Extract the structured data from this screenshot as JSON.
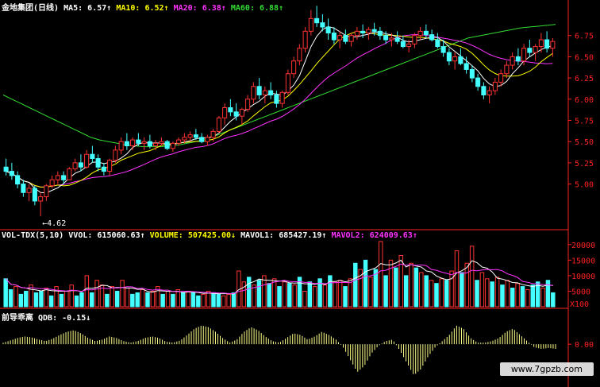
{
  "headers": {
    "price": {
      "title": "金地集团(日线)",
      "items": [
        {
          "label": "MA5: 6.57↑",
          "color": "#ffffff"
        },
        {
          "label": "MA10: 6.52↑",
          "color": "#ffff00"
        },
        {
          "label": "MA20: 6.38↑",
          "color": "#ff33ff"
        },
        {
          "label": "MA60: 6.88↑",
          "color": "#33dd33"
        }
      ]
    },
    "volume": {
      "items": [
        {
          "label": "VOL-TDX(5,10) VVOL: 615060.63↑",
          "color": "#ffffff"
        },
        {
          "label": "VOLUME: 507425.00↓",
          "color": "#ffff00"
        },
        {
          "label": "MAVOL1: 685427.19↑",
          "color": "#ffffff"
        },
        {
          "label": "MAVOL2: 624009.63↑",
          "color": "#ff33ff"
        }
      ]
    },
    "indicator": {
      "items": [
        {
          "label": "前导乖离 QDB: -0.15↓",
          "color": "#ffffff"
        }
      ]
    }
  },
  "watermark": "www.7gpzb.com",
  "colors": {
    "up": "#ff3333",
    "down": "#44ffff",
    "ma5": "#ffffff",
    "ma10": "#ffff00",
    "ma20": "#ff33ff",
    "ma60": "#33dd33",
    "axis": "#ff2222",
    "bars": "#ffff88"
  },
  "chart_data": [
    {
      "type": "candlestick",
      "title": "金地集团(日线)",
      "ylim": [
        4.5,
        7.0
      ],
      "y_ticks": [
        5.0,
        5.25,
        5.5,
        5.75,
        6.0,
        6.25,
        6.5,
        6.75
      ],
      "annotation": "←4.62",
      "low_annotation_value": 4.62,
      "candles": [
        [
          5.2,
          5.3,
          5.1,
          5.15
        ],
        [
          5.15,
          5.25,
          5.05,
          5.1
        ],
        [
          5.1,
          5.15,
          4.95,
          5.0
        ],
        [
          5.0,
          5.05,
          4.85,
          4.9
        ],
        [
          4.9,
          5.0,
          4.8,
          4.95
        ],
        [
          4.95,
          4.98,
          4.75,
          4.8
        ],
        [
          4.8,
          4.9,
          4.62,
          4.85
        ],
        [
          4.85,
          5.0,
          4.8,
          4.98
        ],
        [
          4.98,
          5.1,
          4.95,
          5.05
        ],
        [
          5.05,
          5.15,
          5.0,
          5.1
        ],
        [
          5.1,
          5.15,
          5.0,
          5.05
        ],
        [
          5.05,
          5.2,
          5.05,
          5.18
        ],
        [
          5.18,
          5.3,
          5.15,
          5.25
        ],
        [
          5.25,
          5.35,
          5.15,
          5.2
        ],
        [
          5.2,
          5.4,
          5.18,
          5.35
        ],
        [
          5.35,
          5.45,
          5.25,
          5.3
        ],
        [
          5.3,
          5.35,
          5.15,
          5.2
        ],
        [
          5.2,
          5.25,
          5.1,
          5.15
        ],
        [
          5.15,
          5.3,
          5.1,
          5.28
        ],
        [
          5.28,
          5.45,
          5.25,
          5.4
        ],
        [
          5.4,
          5.55,
          5.35,
          5.5
        ],
        [
          5.5,
          5.6,
          5.4,
          5.45
        ],
        [
          5.45,
          5.55,
          5.4,
          5.52
        ],
        [
          5.52,
          5.6,
          5.45,
          5.48
        ],
        [
          5.48,
          5.55,
          5.4,
          5.5
        ],
        [
          5.5,
          5.58,
          5.42,
          5.45
        ],
        [
          5.45,
          5.52,
          5.4,
          5.48
        ],
        [
          5.48,
          5.55,
          5.45,
          5.5
        ],
        [
          5.5,
          5.52,
          5.4,
          5.42
        ],
        [
          5.42,
          5.5,
          5.38,
          5.48
        ],
        [
          5.48,
          5.55,
          5.45,
          5.52
        ],
        [
          5.52,
          5.6,
          5.48,
          5.55
        ],
        [
          5.55,
          5.62,
          5.5,
          5.58
        ],
        [
          5.58,
          5.65,
          5.52,
          5.55
        ],
        [
          5.55,
          5.6,
          5.48,
          5.5
        ],
        [
          5.5,
          5.58,
          5.45,
          5.55
        ],
        [
          5.55,
          5.65,
          5.5,
          5.62
        ],
        [
          5.62,
          5.8,
          5.6,
          5.78
        ],
        [
          5.78,
          5.95,
          5.7,
          5.9
        ],
        [
          5.9,
          6.0,
          5.8,
          5.85
        ],
        [
          5.85,
          5.95,
          5.75,
          5.8
        ],
        [
          5.8,
          5.9,
          5.7,
          5.88
        ],
        [
          5.88,
          6.05,
          5.85,
          6.0
        ],
        [
          6.0,
          6.2,
          5.95,
          6.15
        ],
        [
          6.15,
          6.25,
          6.0,
          6.05
        ],
        [
          6.05,
          6.15,
          5.95,
          6.1
        ],
        [
          6.1,
          6.2,
          6.0,
          6.05
        ],
        [
          6.05,
          6.1,
          5.9,
          5.95
        ],
        [
          5.95,
          6.1,
          5.9,
          6.08
        ],
        [
          6.08,
          6.35,
          6.05,
          6.3
        ],
        [
          6.3,
          6.5,
          6.25,
          6.45
        ],
        [
          6.45,
          6.65,
          6.4,
          6.6
        ],
        [
          6.6,
          6.85,
          6.55,
          6.8
        ],
        [
          6.8,
          7.05,
          6.75,
          6.95
        ],
        [
          6.95,
          7.1,
          6.85,
          6.9
        ],
        [
          6.9,
          7.0,
          6.8,
          6.85
        ],
        [
          6.85,
          6.95,
          6.7,
          6.78
        ],
        [
          6.78,
          6.85,
          6.65,
          6.7
        ],
        [
          6.7,
          6.8,
          6.6,
          6.75
        ],
        [
          6.75,
          6.82,
          6.65,
          6.68
        ],
        [
          6.68,
          6.78,
          6.62,
          6.75
        ],
        [
          6.75,
          6.85,
          6.7,
          6.8
        ],
        [
          6.8,
          6.88,
          6.72,
          6.78
        ],
        [
          6.78,
          6.85,
          6.7,
          6.82
        ],
        [
          6.82,
          6.9,
          6.75,
          6.8
        ],
        [
          6.8,
          6.85,
          6.7,
          6.75
        ],
        [
          6.75,
          6.8,
          6.65,
          6.7
        ],
        [
          6.7,
          6.78,
          6.62,
          6.72
        ],
        [
          6.72,
          6.8,
          6.65,
          6.68
        ],
        [
          6.68,
          6.75,
          6.6,
          6.62
        ],
        [
          6.62,
          6.7,
          6.55,
          6.65
        ],
        [
          6.65,
          6.78,
          6.6,
          6.75
        ],
        [
          6.75,
          6.85,
          6.7,
          6.8
        ],
        [
          6.8,
          6.88,
          6.72,
          6.76
        ],
        [
          6.76,
          6.82,
          6.68,
          6.7
        ],
        [
          6.7,
          6.78,
          6.6,
          6.62
        ],
        [
          6.62,
          6.7,
          6.5,
          6.55
        ],
        [
          6.55,
          6.6,
          6.4,
          6.45
        ],
        [
          6.45,
          6.55,
          6.35,
          6.5
        ],
        [
          6.5,
          6.6,
          6.4,
          6.42
        ],
        [
          6.42,
          6.5,
          6.3,
          6.35
        ],
        [
          6.35,
          6.4,
          6.2,
          6.25
        ],
        [
          6.25,
          6.3,
          6.1,
          6.15
        ],
        [
          6.15,
          6.2,
          6.0,
          6.05
        ],
        [
          6.05,
          6.15,
          5.95,
          6.1
        ],
        [
          6.1,
          6.25,
          6.05,
          6.2
        ],
        [
          6.2,
          6.35,
          6.15,
          6.3
        ],
        [
          6.3,
          6.45,
          6.25,
          6.4
        ],
        [
          6.4,
          6.55,
          6.35,
          6.5
        ],
        [
          6.5,
          6.6,
          6.4,
          6.45
        ],
        [
          6.45,
          6.65,
          6.4,
          6.6
        ],
        [
          6.6,
          6.7,
          6.5,
          6.55
        ],
        [
          6.55,
          6.65,
          6.45,
          6.62
        ],
        [
          6.62,
          6.78,
          6.55,
          6.7
        ],
        [
          6.7,
          6.8,
          6.55,
          6.6
        ],
        [
          6.6,
          6.72,
          6.5,
          6.68
        ]
      ],
      "ma60": [
        6.05,
        6.0,
        5.95,
        5.9,
        5.85,
        5.8,
        5.75,
        5.7,
        5.65,
        5.6,
        5.55,
        5.52,
        5.5,
        5.48,
        5.46,
        5.45,
        5.44,
        5.44,
        5.44,
        5.45,
        5.46,
        5.48,
        5.5,
        5.53,
        5.56,
        5.6,
        5.64,
        5.68,
        5.72,
        5.76,
        5.8,
        5.84,
        5.88,
        5.92,
        5.96,
        6.0,
        6.04,
        6.08,
        6.12,
        6.16,
        6.2,
        6.24,
        6.28,
        6.32,
        6.36,
        6.4,
        6.44,
        6.48,
        6.52,
        6.56,
        6.6,
        6.64,
        6.68,
        6.72,
        6.74,
        6.76,
        6.78,
        6.8,
        6.82,
        6.84,
        6.85,
        6.86,
        6.87,
        6.88
      ]
    },
    {
      "type": "bar",
      "title": "VOL-TDX(5,10)",
      "ylim": [
        0,
        22000
      ],
      "y_ticks": [
        5000,
        10000,
        15000,
        20000
      ],
      "y_unit": "X100",
      "values": [
        9000,
        5500,
        6500,
        4000,
        5000,
        7000,
        4500,
        5000,
        6000,
        3500,
        6500,
        4000,
        5000,
        7000,
        3500,
        4500,
        10000,
        4500,
        8500,
        7000,
        4000,
        6500,
        5000,
        8500,
        6000,
        4000,
        4500,
        5500,
        4500,
        5000,
        6500,
        4000,
        5000,
        4000,
        5500,
        4500,
        5000,
        4500,
        3500,
        4000,
        5000,
        4500,
        4000,
        3500,
        4000,
        4500,
        11500,
        8000,
        9500,
        7000,
        8500,
        10000,
        7500,
        9000,
        6500,
        8000,
        7500,
        7000,
        9500,
        5000,
        8000,
        6500,
        9000,
        7000,
        10000,
        8000,
        8500,
        6500,
        9000,
        14000,
        12000,
        15000,
        9500,
        12000,
        21000,
        10000,
        15000,
        12500,
        16500,
        10000,
        14000,
        12500,
        11000,
        10000,
        8500,
        7500,
        9000,
        8500,
        11500,
        18000,
        11000,
        14000,
        19500,
        8500,
        11000,
        9000,
        8000,
        9500,
        7000,
        8500,
        6000,
        7500,
        6500,
        5500,
        7000,
        8000,
        6000,
        8500,
        4500
      ],
      "colors": [
        "down",
        "down",
        "up",
        "down",
        "down",
        "up",
        "down",
        "down",
        "up",
        "down",
        "up",
        "down",
        "up",
        "up",
        "down",
        "down",
        "up",
        "down",
        "up",
        "up",
        "down",
        "up",
        "down",
        "up",
        "up",
        "down",
        "down",
        "up",
        "down",
        "up",
        "up",
        "down",
        "up",
        "down",
        "up",
        "down",
        "up",
        "down",
        "down",
        "up",
        "up",
        "down",
        "down",
        "up",
        "up",
        "down",
        "up",
        "up",
        "down",
        "up",
        "down",
        "up",
        "down",
        "up",
        "down",
        "up",
        "down",
        "up",
        "down",
        "up",
        "down",
        "up",
        "down",
        "up",
        "down",
        "up",
        "up",
        "down",
        "up",
        "down",
        "up",
        "down",
        "up",
        "down",
        "up",
        "down",
        "up",
        "down",
        "up",
        "down",
        "up",
        "down",
        "up",
        "down",
        "up",
        "down",
        "up",
        "down",
        "up",
        "up",
        "down",
        "up",
        "up",
        "down",
        "up",
        "up",
        "down",
        "up",
        "down",
        "up",
        "down",
        "up",
        "down",
        "up",
        "down",
        "down",
        "up",
        "down",
        "down"
      ]
    },
    {
      "type": "bar",
      "title": "前导乖离 QDB",
      "ylim": [
        -1.2,
        0.9
      ],
      "y_ticks": [
        0.0
      ],
      "values": [
        0.05,
        0.12,
        0.2,
        0.25,
        0.22,
        0.15,
        0.1,
        0.18,
        0.3,
        0.4,
        0.45,
        0.35,
        0.2,
        0.1,
        0.15,
        0.25,
        0.2,
        0.1,
        0.05,
        0.1,
        0.2,
        0.25,
        0.2,
        0.08,
        0.05,
        0.12,
        0.3,
        0.5,
        0.6,
        0.55,
        0.4,
        0.2,
        0.05,
        0.15,
        0.4,
        0.55,
        0.45,
        0.25,
        0.1,
        0.05,
        0.2,
        0.35,
        0.3,
        0.15,
        0.25,
        0.4,
        0.3,
        0.15,
        -0.1,
        -0.5,
        -0.9,
        -0.7,
        -0.3,
        -0.05,
        0.1,
        0.15,
        -0.2,
        -0.6,
        -1.0,
        -0.8,
        -0.4,
        -0.1,
        0.1,
        0.3,
        0.6,
        0.5,
        0.2,
        0.05,
        0.05,
        0.1,
        0.2,
        0.4,
        0.5,
        0.3,
        0.1,
        -0.1,
        -0.15,
        -0.12,
        -0.15
      ]
    }
  ]
}
